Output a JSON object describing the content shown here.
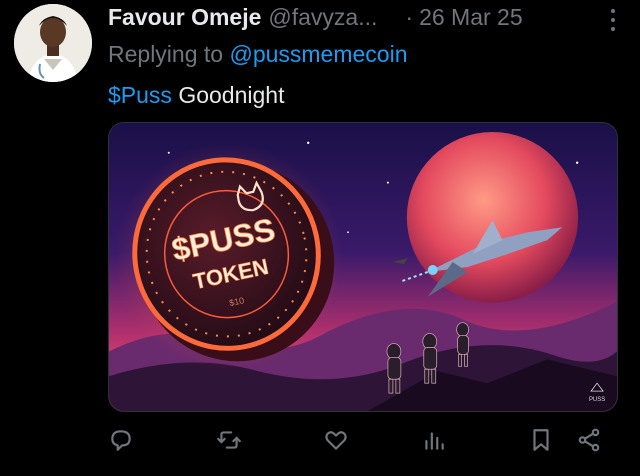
{
  "author": {
    "name": "Favour Omeje",
    "handle": "@favyza...",
    "separator": "·",
    "date": "26 Mar 25"
  },
  "reply": {
    "prefix": "Replying to ",
    "mention": "@pussmemecoin"
  },
  "text": {
    "cashtag": "$Puss",
    "rest": " Goodnight"
  },
  "media": {
    "coin_line1": "$PUSS",
    "coin_line2": "TOKEN",
    "coin_small": "$10",
    "watermark": "PUSS"
  },
  "colors": {
    "accent": "#1d9bf0",
    "muted": "#71767b",
    "text": "#e7e9ea",
    "background": "#000000"
  },
  "actions": [
    "reply-icon",
    "repost-icon",
    "like-icon",
    "views-icon",
    "bookmark-icon",
    "share-icon"
  ]
}
